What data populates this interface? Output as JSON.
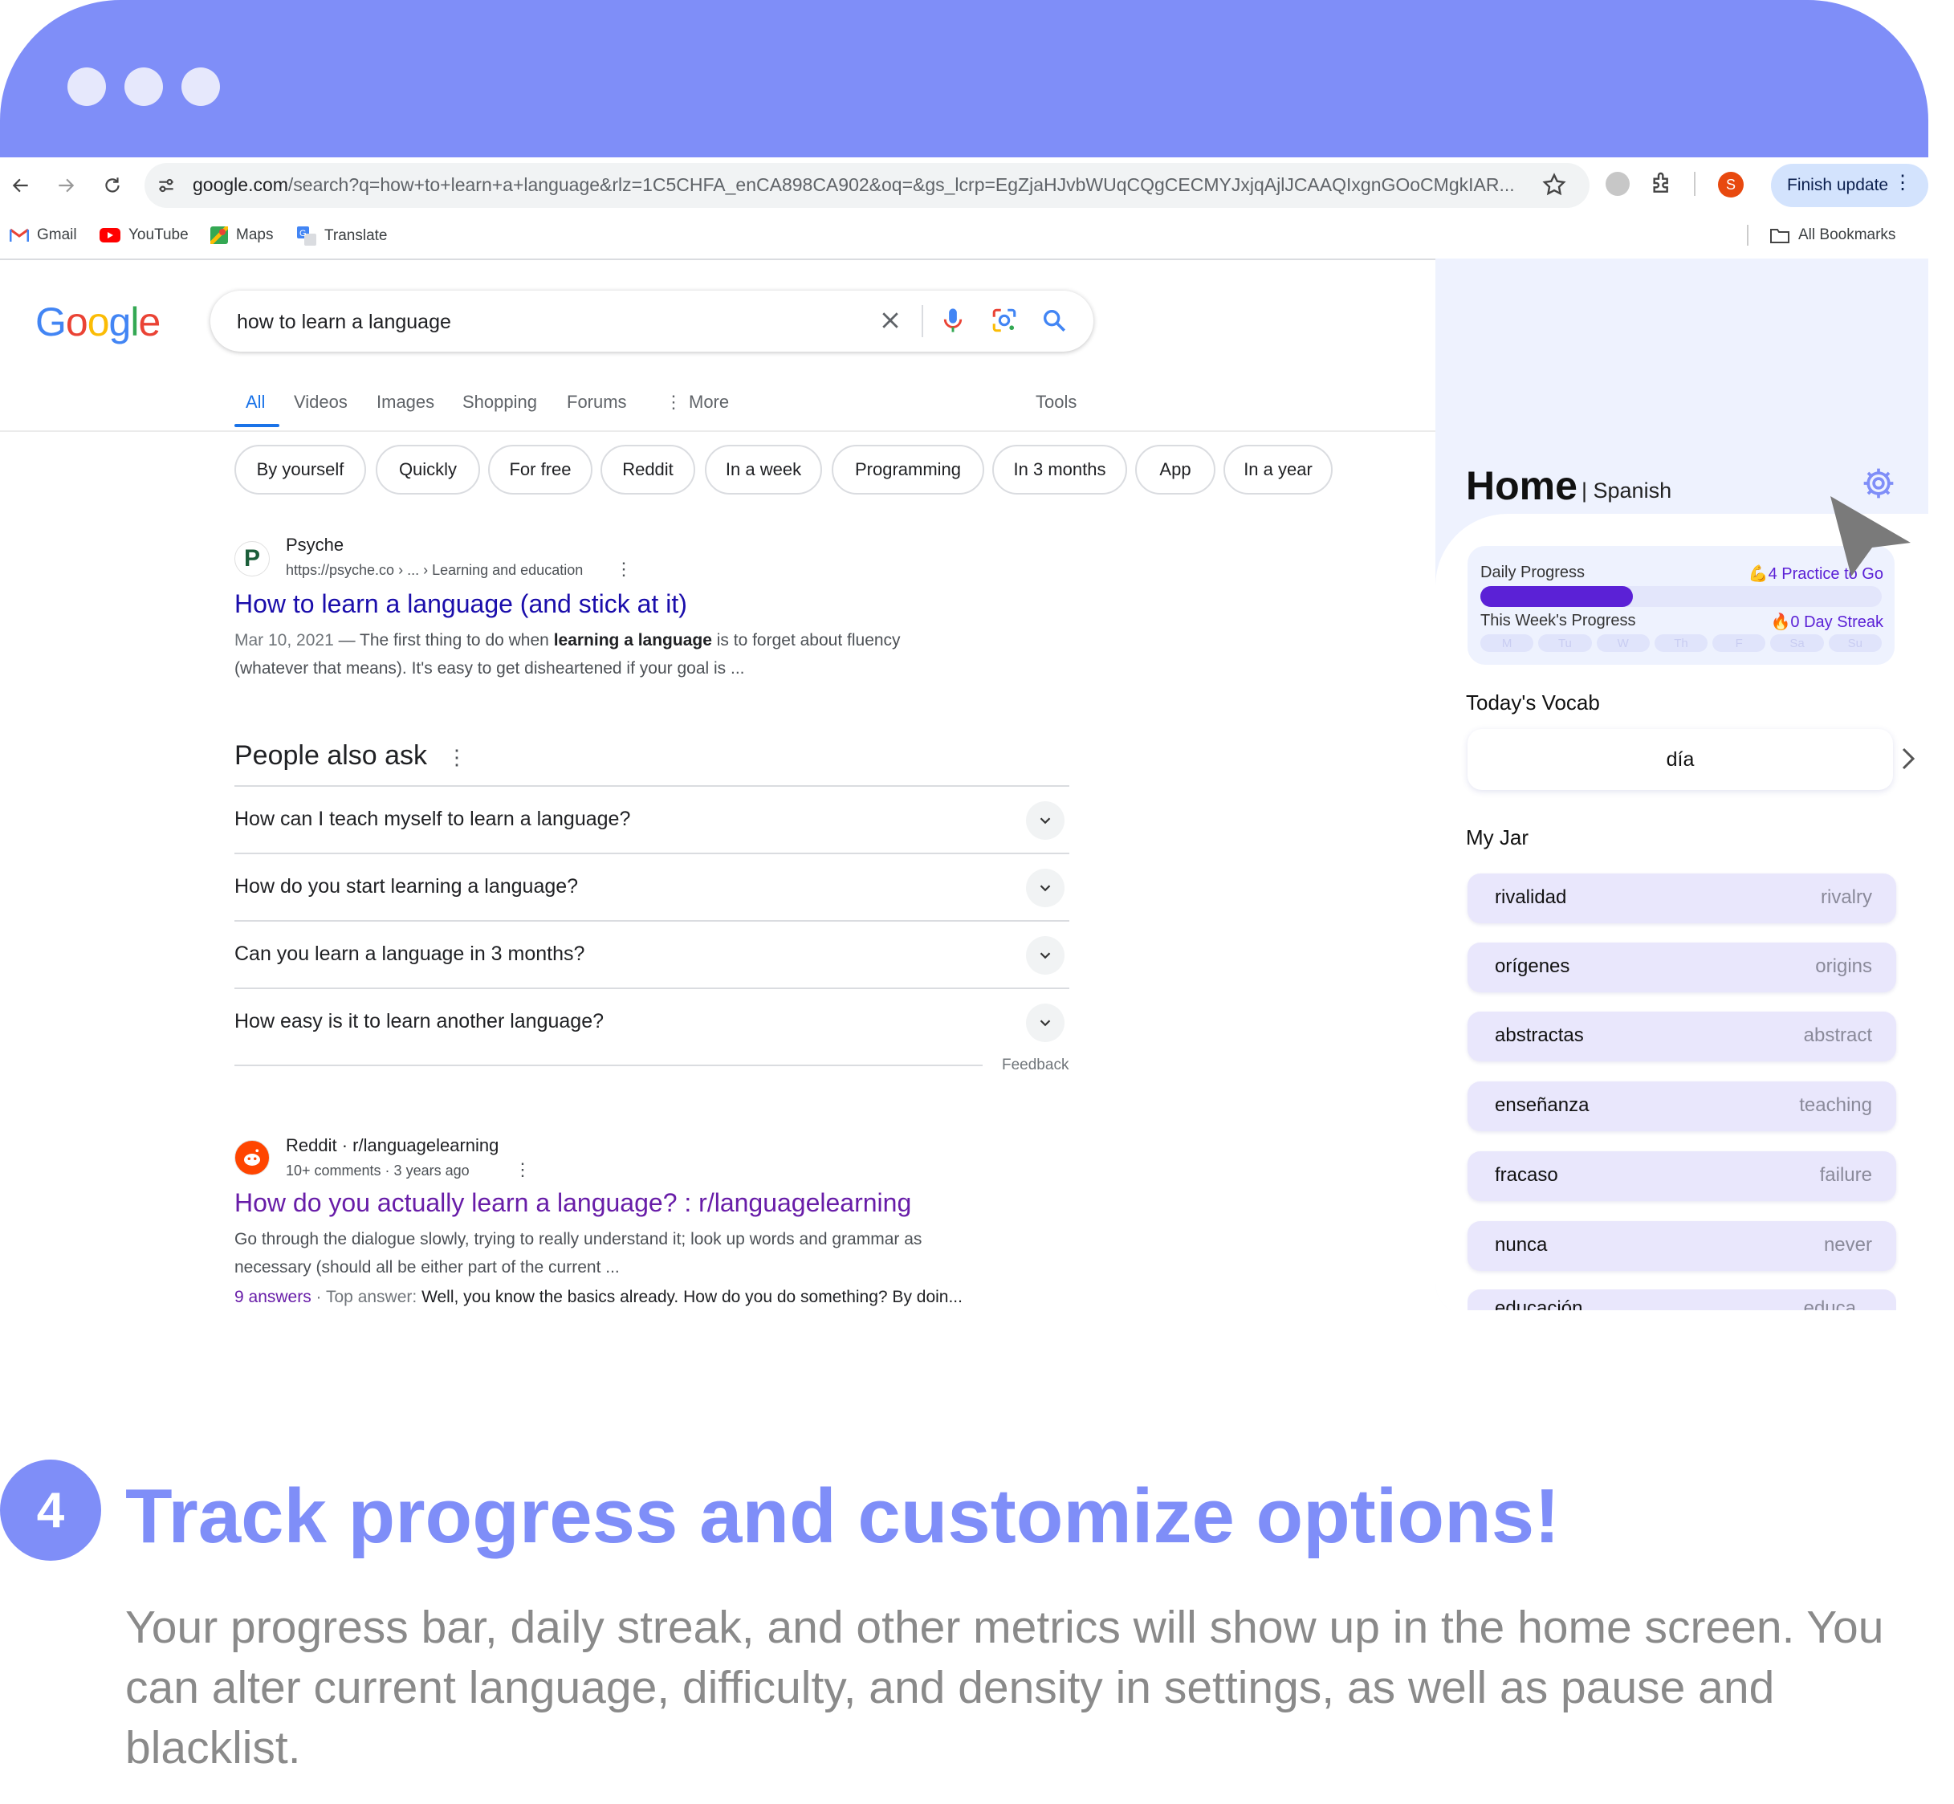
{
  "browser": {
    "url_host": "google.com",
    "url_rest": "/search?q=how+to+learn+a+language&rlz=1C5CHFA_enCA898CA902&oq=&gs_lcrp=EgZjaHJvbWUqCQgCECMYJxjqAjlJCAAQIxgnGOoCMgkIAR...",
    "profile_initial": "S",
    "finish_update": "Finish update",
    "bookmarks": [
      "Gmail",
      "YouTube",
      "Maps",
      "Translate"
    ],
    "all_bookmarks": "All Bookmarks"
  },
  "google": {
    "logo": [
      "G",
      "o",
      "o",
      "g",
      "l",
      "e"
    ],
    "logo_colors": [
      "#4285f4",
      "#ea4335",
      "#fbbc05",
      "#4285f4",
      "#34a853",
      "#ea4335"
    ],
    "query": "how to learn a language",
    "tabs": [
      "All",
      "Videos",
      "Images",
      "Shopping",
      "Forums",
      "More"
    ],
    "tools": "Tools",
    "chips": [
      "By yourself",
      "Quickly",
      "For free",
      "Reddit",
      "In a week",
      "Programming",
      "In 3 months",
      "App",
      "In a year"
    ],
    "result1": {
      "favicon": "P",
      "site": "Psyche",
      "url": "https://psyche.co › ... › Learning and education",
      "title": "How to learn a language (and stick at it)",
      "date": "Mar 10, 2021",
      "snippet_a": " — The first thing to do when ",
      "snippet_b": "learning a language",
      "snippet_c": " is to forget about fluency",
      "snippet_d": "(whatever that means). It's easy to get disheartened if your goal is ..."
    },
    "paa": {
      "heading": "People also ask",
      "questions": [
        "How can I teach myself to learn a language?",
        "How do you start learning a language?",
        "Can you learn a language in 3 months?",
        "How easy is it to learn another language?"
      ],
      "feedback": "Feedback"
    },
    "result2": {
      "site": "Reddit · r/languagelearning",
      "meta": "10+ comments · 3 years ago",
      "title": "How do you actually learn a language? : r/languagelearning",
      "snippet_1": "Go through the dialogue slowly, trying to really understand it; look up words and grammar as",
      "snippet_2": "necessary (should all be either part of the current ...",
      "answers": "9 answers",
      "top_answer_label": " · Top answer: ",
      "top_answer": "Well, you know the basics already. How do you do something? By doin..."
    }
  },
  "extension": {
    "title": "Home",
    "language": "| Spanish",
    "daily_progress_label": "Daily Progress",
    "daily_progress_right": "💪4 Practice to Go",
    "daily_progress_fraction": 0.38,
    "week_label": "This Week's Progress",
    "week_right": "🔥0 Day Streak",
    "days": [
      "M",
      "Tu",
      "W",
      "Th",
      "F",
      "Sa",
      "Su"
    ],
    "vocab_heading": "Today's Vocab",
    "vocab_word": "día",
    "jar_heading": "My Jar",
    "jar": [
      {
        "es": "rivalidad",
        "en": "rivalry"
      },
      {
        "es": "orígenes",
        "en": "origins"
      },
      {
        "es": "abstractas",
        "en": "abstract"
      },
      {
        "es": "enseñanza",
        "en": "teaching"
      },
      {
        "es": "fracaso",
        "en": "failure"
      },
      {
        "es": "nunca",
        "en": "never"
      },
      {
        "es": "educación",
        "en": "educa..."
      }
    ],
    "accent": "#5b21d6"
  },
  "caption": {
    "step": "4",
    "headline": "Track progress and customize options!",
    "body": "Your progress bar, daily streak, and other metrics will show up in the home screen. You can alter current language, difficulty, and density in settings, as well as pause and blacklist."
  },
  "colors": {
    "frame": "#7f8ef8",
    "link": "#1a0dab",
    "visited": "#681da8"
  }
}
